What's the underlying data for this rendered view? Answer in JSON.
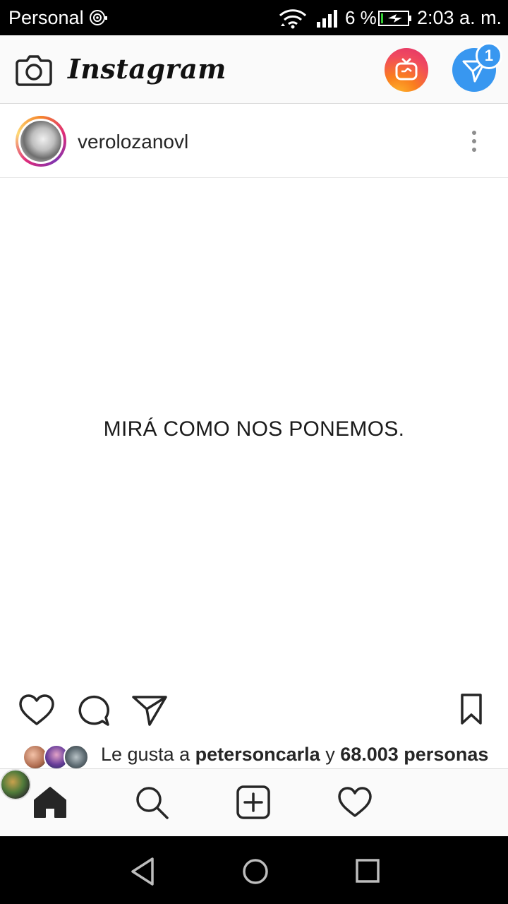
{
  "status_bar": {
    "carrier": "Personal",
    "battery_percent": "6 %",
    "time": "2:03 a. m.",
    "icons": [
      "hotspot-icon",
      "wifi-icon",
      "signal-icon",
      "battery-charging-icon"
    ]
  },
  "app_bar": {
    "logo": "Instagram",
    "direct_badge": "1",
    "icons": [
      "camera-icon",
      "igtv-icon",
      "direct-icon"
    ]
  },
  "post": {
    "username": "verolozanovl",
    "image_text": "MIRÁ COMO NOS PONEMOS.",
    "likes": {
      "prefix": "Le gusta a ",
      "user": "petersoncarla",
      "middle": " y ",
      "count": "68.003 personas"
    }
  },
  "bottom_nav": {
    "items": [
      "home-icon",
      "search-icon",
      "add-post-icon",
      "activity-heart-icon",
      "profile-avatar"
    ]
  },
  "system_nav": {
    "items": [
      "back-icon",
      "home-circle-icon",
      "recents-icon"
    ]
  },
  "colors": {
    "accent_blue": "#3897f0",
    "text": "#262626"
  }
}
